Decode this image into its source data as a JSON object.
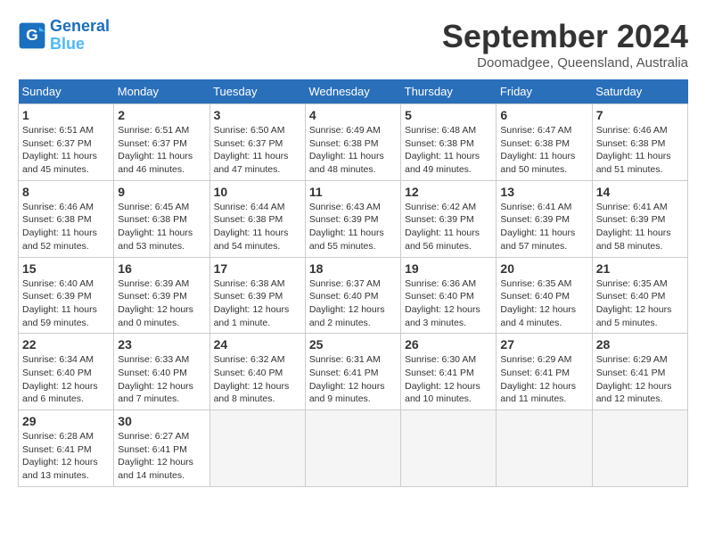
{
  "logo": {
    "line1": "General",
    "line2": "Blue"
  },
  "title": "September 2024",
  "subtitle": "Doomadgee, Queensland, Australia",
  "header": {
    "accent_color": "#2a6fba"
  },
  "days_of_week": [
    "Sunday",
    "Monday",
    "Tuesday",
    "Wednesday",
    "Thursday",
    "Friday",
    "Saturday"
  ],
  "weeks": [
    [
      {
        "day": "1",
        "rise": "6:51 AM",
        "set": "6:37 PM",
        "daylight": "11 hours and 45 minutes."
      },
      {
        "day": "2",
        "rise": "6:51 AM",
        "set": "6:37 PM",
        "daylight": "11 hours and 46 minutes."
      },
      {
        "day": "3",
        "rise": "6:50 AM",
        "set": "6:37 PM",
        "daylight": "11 hours and 47 minutes."
      },
      {
        "day": "4",
        "rise": "6:49 AM",
        "set": "6:38 PM",
        "daylight": "11 hours and 48 minutes."
      },
      {
        "day": "5",
        "rise": "6:48 AM",
        "set": "6:38 PM",
        "daylight": "11 hours and 49 minutes."
      },
      {
        "day": "6",
        "rise": "6:47 AM",
        "set": "6:38 PM",
        "daylight": "11 hours and 50 minutes."
      },
      {
        "day": "7",
        "rise": "6:46 AM",
        "set": "6:38 PM",
        "daylight": "11 hours and 51 minutes."
      }
    ],
    [
      {
        "day": "8",
        "rise": "6:46 AM",
        "set": "6:38 PM",
        "daylight": "11 hours and 52 minutes."
      },
      {
        "day": "9",
        "rise": "6:45 AM",
        "set": "6:38 PM",
        "daylight": "11 hours and 53 minutes."
      },
      {
        "day": "10",
        "rise": "6:44 AM",
        "set": "6:38 PM",
        "daylight": "11 hours and 54 minutes."
      },
      {
        "day": "11",
        "rise": "6:43 AM",
        "set": "6:39 PM",
        "daylight": "11 hours and 55 minutes."
      },
      {
        "day": "12",
        "rise": "6:42 AM",
        "set": "6:39 PM",
        "daylight": "11 hours and 56 minutes."
      },
      {
        "day": "13",
        "rise": "6:41 AM",
        "set": "6:39 PM",
        "daylight": "11 hours and 57 minutes."
      },
      {
        "day": "14",
        "rise": "6:41 AM",
        "set": "6:39 PM",
        "daylight": "11 hours and 58 minutes."
      }
    ],
    [
      {
        "day": "15",
        "rise": "6:40 AM",
        "set": "6:39 PM",
        "daylight": "11 hours and 59 minutes."
      },
      {
        "day": "16",
        "rise": "6:39 AM",
        "set": "6:39 PM",
        "daylight": "12 hours and 0 minutes."
      },
      {
        "day": "17",
        "rise": "6:38 AM",
        "set": "6:39 PM",
        "daylight": "12 hours and 1 minute."
      },
      {
        "day": "18",
        "rise": "6:37 AM",
        "set": "6:40 PM",
        "daylight": "12 hours and 2 minutes."
      },
      {
        "day": "19",
        "rise": "6:36 AM",
        "set": "6:40 PM",
        "daylight": "12 hours and 3 minutes."
      },
      {
        "day": "20",
        "rise": "6:35 AM",
        "set": "6:40 PM",
        "daylight": "12 hours and 4 minutes."
      },
      {
        "day": "21",
        "rise": "6:35 AM",
        "set": "6:40 PM",
        "daylight": "12 hours and 5 minutes."
      }
    ],
    [
      {
        "day": "22",
        "rise": "6:34 AM",
        "set": "6:40 PM",
        "daylight": "12 hours and 6 minutes."
      },
      {
        "day": "23",
        "rise": "6:33 AM",
        "set": "6:40 PM",
        "daylight": "12 hours and 7 minutes."
      },
      {
        "day": "24",
        "rise": "6:32 AM",
        "set": "6:40 PM",
        "daylight": "12 hours and 8 minutes."
      },
      {
        "day": "25",
        "rise": "6:31 AM",
        "set": "6:41 PM",
        "daylight": "12 hours and 9 minutes."
      },
      {
        "day": "26",
        "rise": "6:30 AM",
        "set": "6:41 PM",
        "daylight": "12 hours and 10 minutes."
      },
      {
        "day": "27",
        "rise": "6:29 AM",
        "set": "6:41 PM",
        "daylight": "12 hours and 11 minutes."
      },
      {
        "day": "28",
        "rise": "6:29 AM",
        "set": "6:41 PM",
        "daylight": "12 hours and 12 minutes."
      }
    ],
    [
      {
        "day": "29",
        "rise": "6:28 AM",
        "set": "6:41 PM",
        "daylight": "12 hours and 13 minutes."
      },
      {
        "day": "30",
        "rise": "6:27 AM",
        "set": "6:41 PM",
        "daylight": "12 hours and 14 minutes."
      },
      null,
      null,
      null,
      null,
      null
    ]
  ]
}
